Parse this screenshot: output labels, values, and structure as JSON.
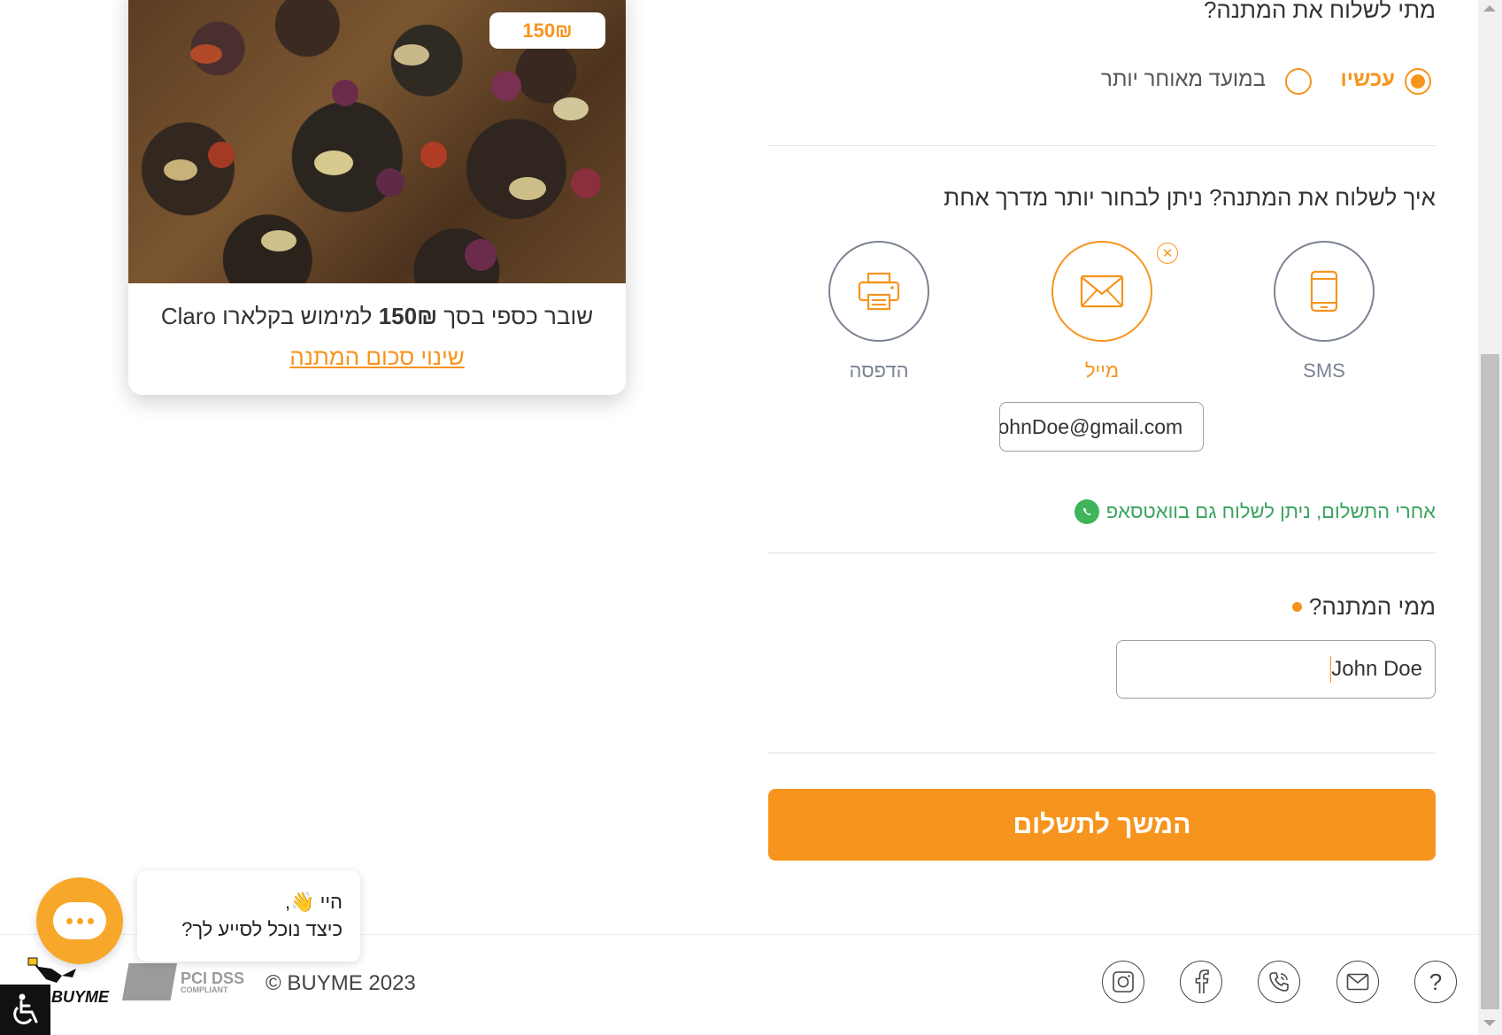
{
  "gift": {
    "price_tag": "150₪",
    "desc_prefix": "שובר כספי בסך ",
    "desc_amount": "150₪",
    "desc_suffix": " למימוש בקלארו Claro",
    "change_amount_link": "שינוי סכום המתנה"
  },
  "when_section": {
    "question": "מתי לשלוח את המתנה?",
    "options": [
      {
        "label": "עכשיו",
        "selected": true
      },
      {
        "label": "במועד מאוחר יותר",
        "selected": false
      }
    ]
  },
  "how_section": {
    "question": "איך לשלוח את המתנה? ניתן לבחור יותר מדרך אחת",
    "methods": [
      {
        "label": "SMS",
        "icon": "mobile-phone-icon",
        "selected": false
      },
      {
        "label": "מייל",
        "icon": "envelope-icon",
        "selected": true
      },
      {
        "label": "הדפסה",
        "icon": "printer-icon",
        "selected": false
      }
    ],
    "email_value": "JohnDoe@gmail.com",
    "whatsapp_note": "אחרי התשלום, ניתן לשלוח גם בוואטסאפ"
  },
  "from_section": {
    "question": "ממי המתנה?",
    "name_value": "John Doe"
  },
  "pay_button": "המשך לתשלום",
  "footer": {
    "copyright": "© BUYME 2023",
    "pci_text": "PCI DSS",
    "pci_sub": "COMPLIANT",
    "logo_text": "BUYME",
    "icons": [
      "help-icon",
      "mail-icon",
      "phone-icon",
      "facebook-icon",
      "instagram-icon"
    ]
  },
  "chat": {
    "greeting": "היי 👋,",
    "question": "כיצד נוכל לסייע לך?"
  },
  "colors": {
    "accent": "#f7941d",
    "whatsapp": "#3fb45a",
    "icon_gray": "#7b8393"
  }
}
